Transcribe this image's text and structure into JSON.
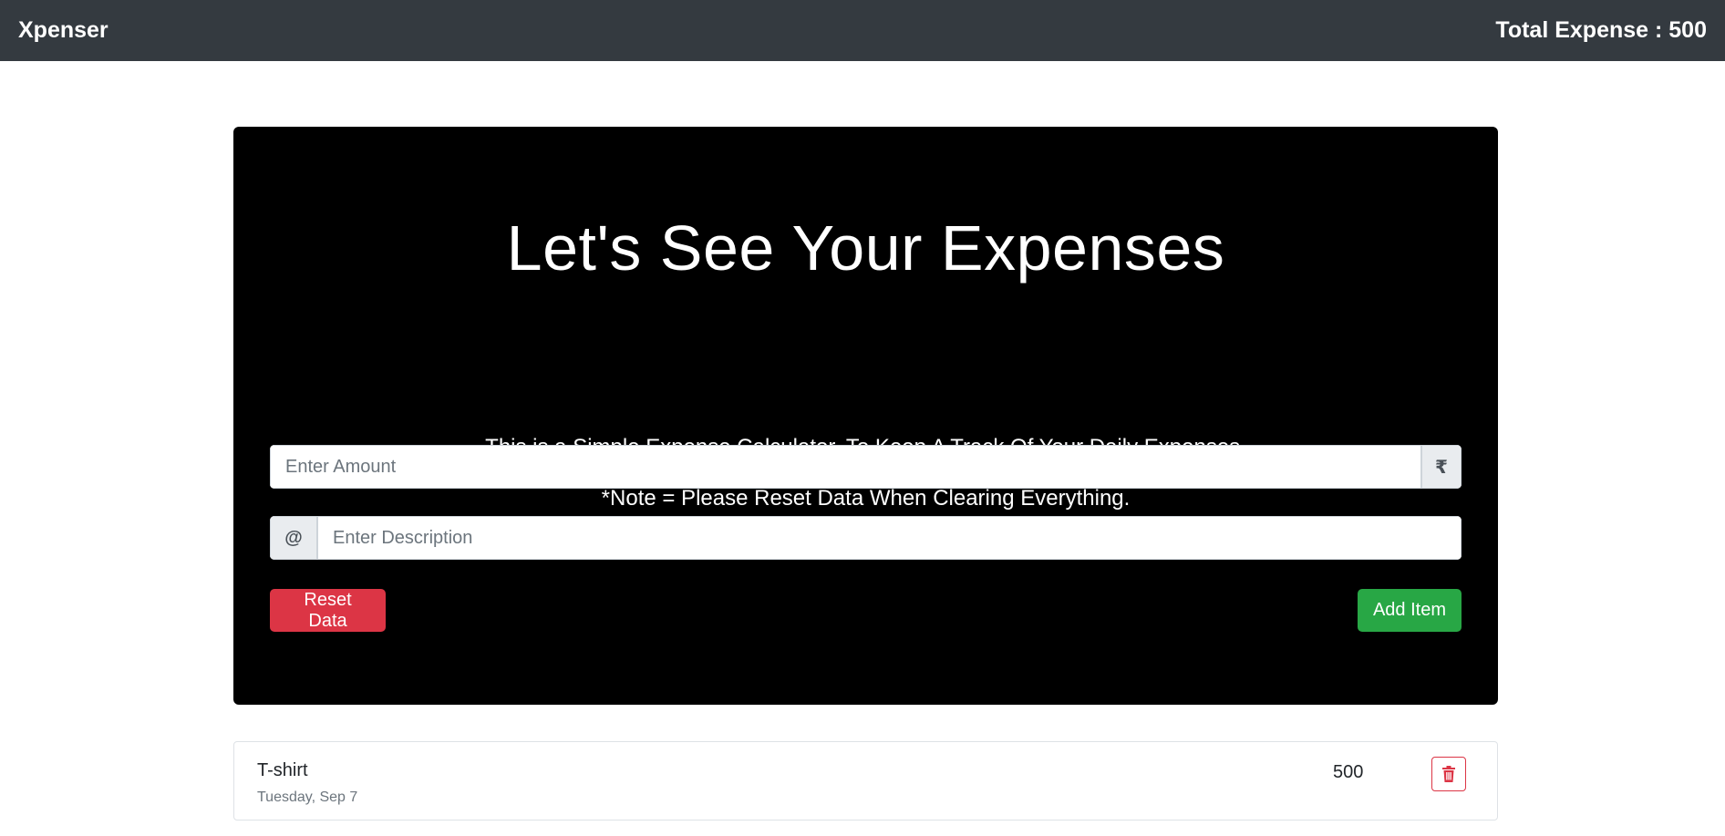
{
  "navbar": {
    "brand": "Xpenser",
    "total_label": "Total Expense : 500"
  },
  "hero": {
    "title": "Let's See Your Expenses",
    "subtitle": "This is a Simple Expense Calculator. To Keep A Track Of Your Daily Expenses.",
    "note": "*Note = Please Reset Data When Clearing Everything."
  },
  "form": {
    "amount_placeholder": "Enter Amount",
    "amount_value": "",
    "currency_symbol": "₹",
    "description_placeholder": "Enter Description",
    "description_value": "",
    "at_symbol": "@",
    "reset_label": "Reset Data",
    "add_label": "Add Item"
  },
  "items": [
    {
      "description": "T-shirt",
      "date": "Tuesday, Sep 7",
      "amount": "500",
      "delete_icon": "trash-icon"
    }
  ],
  "colors": {
    "navbar": "#343a40",
    "danger": "#dc3545",
    "success": "#28a745",
    "hero": "#000000"
  }
}
